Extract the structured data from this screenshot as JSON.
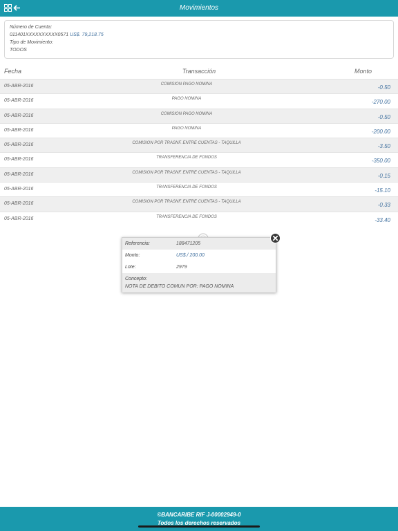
{
  "header": {
    "title": "Movimientos",
    "menu_icon": "grid-icon",
    "back_icon": "arrow-left-icon"
  },
  "account": {
    "number_label": "Número de Cuenta:",
    "number": "011401XXXXXXXXXX0571",
    "balance": "US$. 79,218.75",
    "type_label": "Tipo de Movimiento:",
    "type": "TODOS"
  },
  "table": {
    "headers": {
      "date": "Fecha",
      "transaction": "Transacción",
      "amount": "Monto"
    },
    "rows": [
      {
        "date": "05-ABR-2016",
        "desc": "COMISION PAGO NOMINA",
        "amount": "-0.50"
      },
      {
        "date": "05-ABR-2016",
        "desc": "PAGO NOMINA",
        "amount": "-270.00"
      },
      {
        "date": "05-ABR-2016",
        "desc": "COMISION PAGO NOMINA",
        "amount": "-0.50"
      },
      {
        "date": "05-ABR-2016",
        "desc": "PAGO NOMINA",
        "amount": "-200.00"
      },
      {
        "date": "05-ABR-2016",
        "desc": "COMISION POR TRASNF. ENTRE CUENTAS - TAQUILLA",
        "amount": "-3.50"
      },
      {
        "date": "05-ABR-2016",
        "desc": "TRANSFERENCIA DE FONDOS",
        "amount": "-350.00"
      },
      {
        "date": "05-ABR-2016",
        "desc": "COMISION POR TRASNF. ENTRE CUENTAS - TAQUILLA",
        "amount": "-0.15"
      },
      {
        "date": "05-ABR-2016",
        "desc": "TRANSFERENCIA DE FONDOS",
        "amount": "-15.10"
      },
      {
        "date": "05-ABR-2016",
        "desc": "COMISION POR TRASNF. ENTRE CUENTAS - TAQUILLA",
        "amount": "-0.33"
      },
      {
        "date": "05-ABR-2016",
        "desc": "TRANSFERENCIA DE FONDOS",
        "amount": "-33.40"
      }
    ]
  },
  "popup": {
    "reference_label": "Referencia:",
    "reference": "188471205",
    "amount_label": "Monto:",
    "amount": "US$./ 200.00",
    "batch_label": "Lote:",
    "batch": "2979",
    "concept_label": "Concepto:",
    "concept": "NOTA DE DEBITO COMUN POR: PAGO NOMINA",
    "close_icon": "close-icon"
  },
  "footer": {
    "line1": "©BANCARIBE RIF   J-00002949-0",
    "line2": "Todos los derechos reservados"
  },
  "colors": {
    "brand": "#1a99ad",
    "amount": "#3f6f9e",
    "row_alt": "#efefef"
  }
}
